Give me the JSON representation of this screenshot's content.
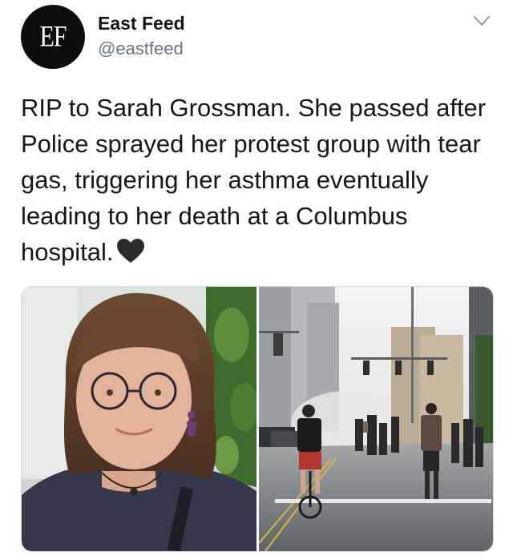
{
  "account": {
    "avatar_text": "EF",
    "display_name": "East Feed",
    "handle": "@eastfeed"
  },
  "menu": {
    "icon": "chevron-down-icon"
  },
  "tweet": {
    "text": "RIP to Sarah Grossman. She passed after Police sprayed her protest group with tear gas, triggering her asthma eventually leading to her death at a Columbus hospital.",
    "emoji": "black-heart-icon"
  },
  "media": {
    "photos": [
      {
        "name": "portrait-photo"
      },
      {
        "name": "protest-street-photo"
      }
    ]
  },
  "colors": {
    "text": "#14171a",
    "secondary": "#657786",
    "avatar_bg": "#0d0d0d"
  }
}
